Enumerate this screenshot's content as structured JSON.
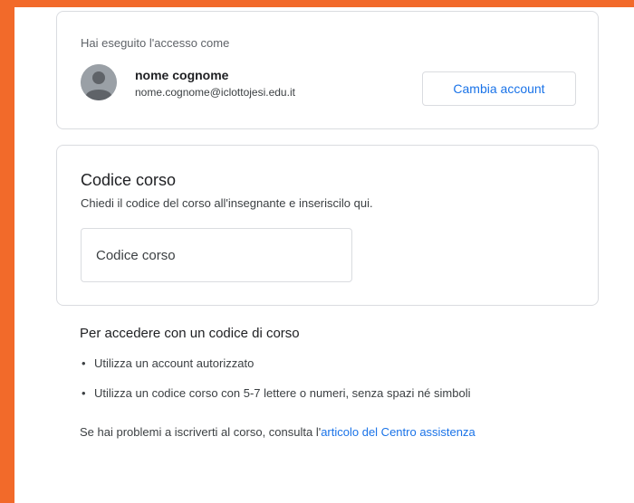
{
  "account": {
    "signed_in_label": "Hai eseguito l'accesso come",
    "user_name": "nome cognome",
    "user_email": "nome.cognome@iclottojesi.edu.it",
    "switch_button_label": "Cambia account"
  },
  "course_code": {
    "title": "Codice corso",
    "subtitle": "Chiedi il codice del corso all'insegnante e inseriscilo qui.",
    "input_placeholder": "Codice corso",
    "input_value": ""
  },
  "help": {
    "heading": "Per accedere con un codice di corso",
    "items": [
      "Utilizza un account autorizzato",
      "Utilizza un codice corso con 5-7 lettere o numeri, senza spazi né simboli"
    ],
    "footer_text": "Se hai problemi a iscriverti al corso, consulta l'",
    "footer_link": "articolo del Centro assistenza"
  },
  "colors": {
    "accent_border": "#f26a2a",
    "link": "#1a73e8",
    "card_border": "#dadce0"
  }
}
